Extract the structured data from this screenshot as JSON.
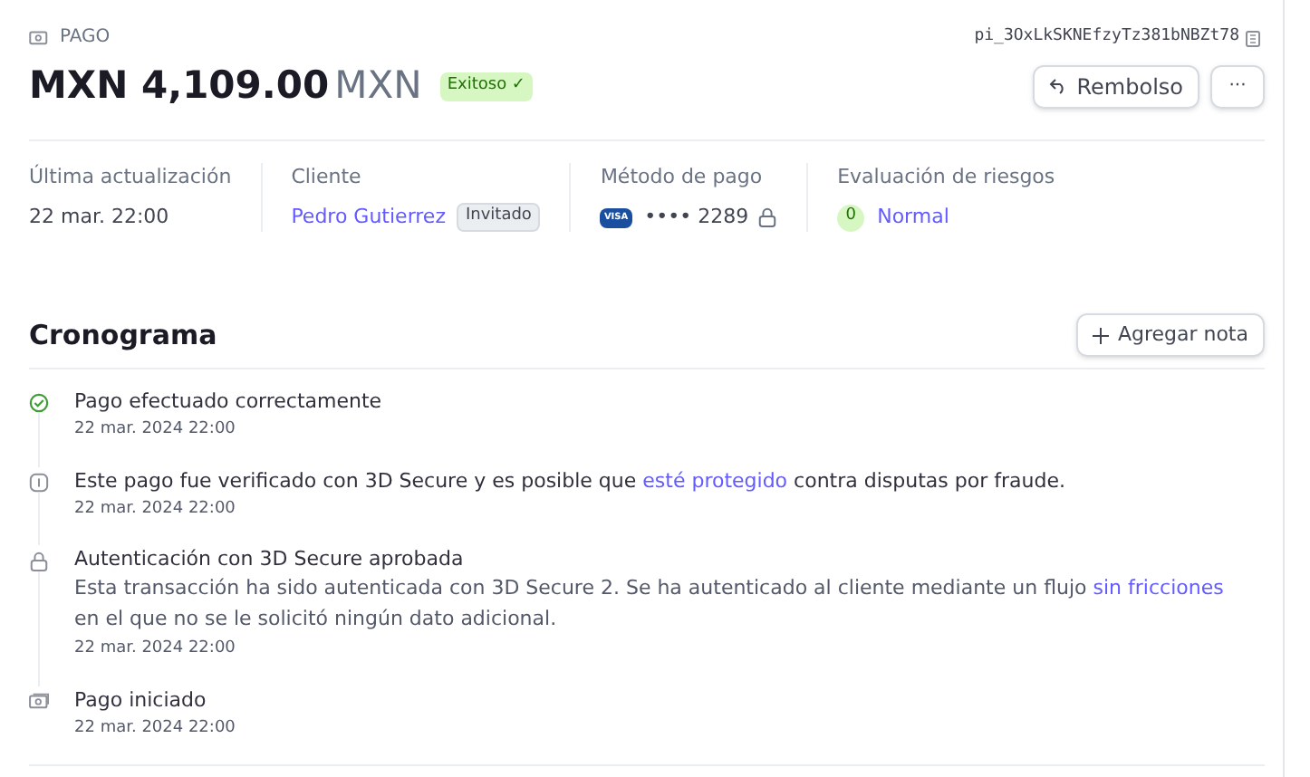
{
  "header": {
    "label": "PAGO",
    "payment_id": "pi_3OxLkSKNEfzyTz381bNBZt78",
    "amount": "MXN 4,109.00",
    "currency": "MXN",
    "status": "Exitoso ✓"
  },
  "actions": {
    "refund": "Rembolso",
    "more": "···"
  },
  "summary": {
    "updated": {
      "label": "Última actualización",
      "value": "22 mar. 22:00"
    },
    "customer": {
      "label": "Cliente",
      "name": "Pedro Gutierrez",
      "badge": "Invitado"
    },
    "payment_method": {
      "label": "Método de pago",
      "brand": "VISA",
      "last4": "•••• 2289"
    },
    "risk": {
      "label": "Evaluación de riesgos",
      "score": "0",
      "level": "Normal"
    }
  },
  "timeline": {
    "title": "Cronograma",
    "add_note": "Agregar nota",
    "events": [
      {
        "kind": "success",
        "title": "Pago efectuado correctamente",
        "time": "22 mar. 2024 22:00"
      },
      {
        "kind": "info",
        "title_before": "Este pago fue verificado con 3D Secure y es posible que ",
        "title_link": "esté protegido",
        "title_after": " contra disputas por fraude.",
        "time": "22 mar. 2024 22:00"
      },
      {
        "kind": "lock",
        "title": "Autenticación con 3D Secure aprobada",
        "detail_before": "Esta transacción ha sido autenticada con 3D Secure 2. Se ha autenticado al cliente mediante un flujo ",
        "detail_link": "sin fricciones",
        "detail_after": " en el que no se le solicitó ningún dato adicional.",
        "time": "22 mar. 2024 22:00"
      },
      {
        "kind": "payment",
        "title": "Pago iniciado",
        "time": "22 mar. 2024 22:00"
      }
    ]
  }
}
